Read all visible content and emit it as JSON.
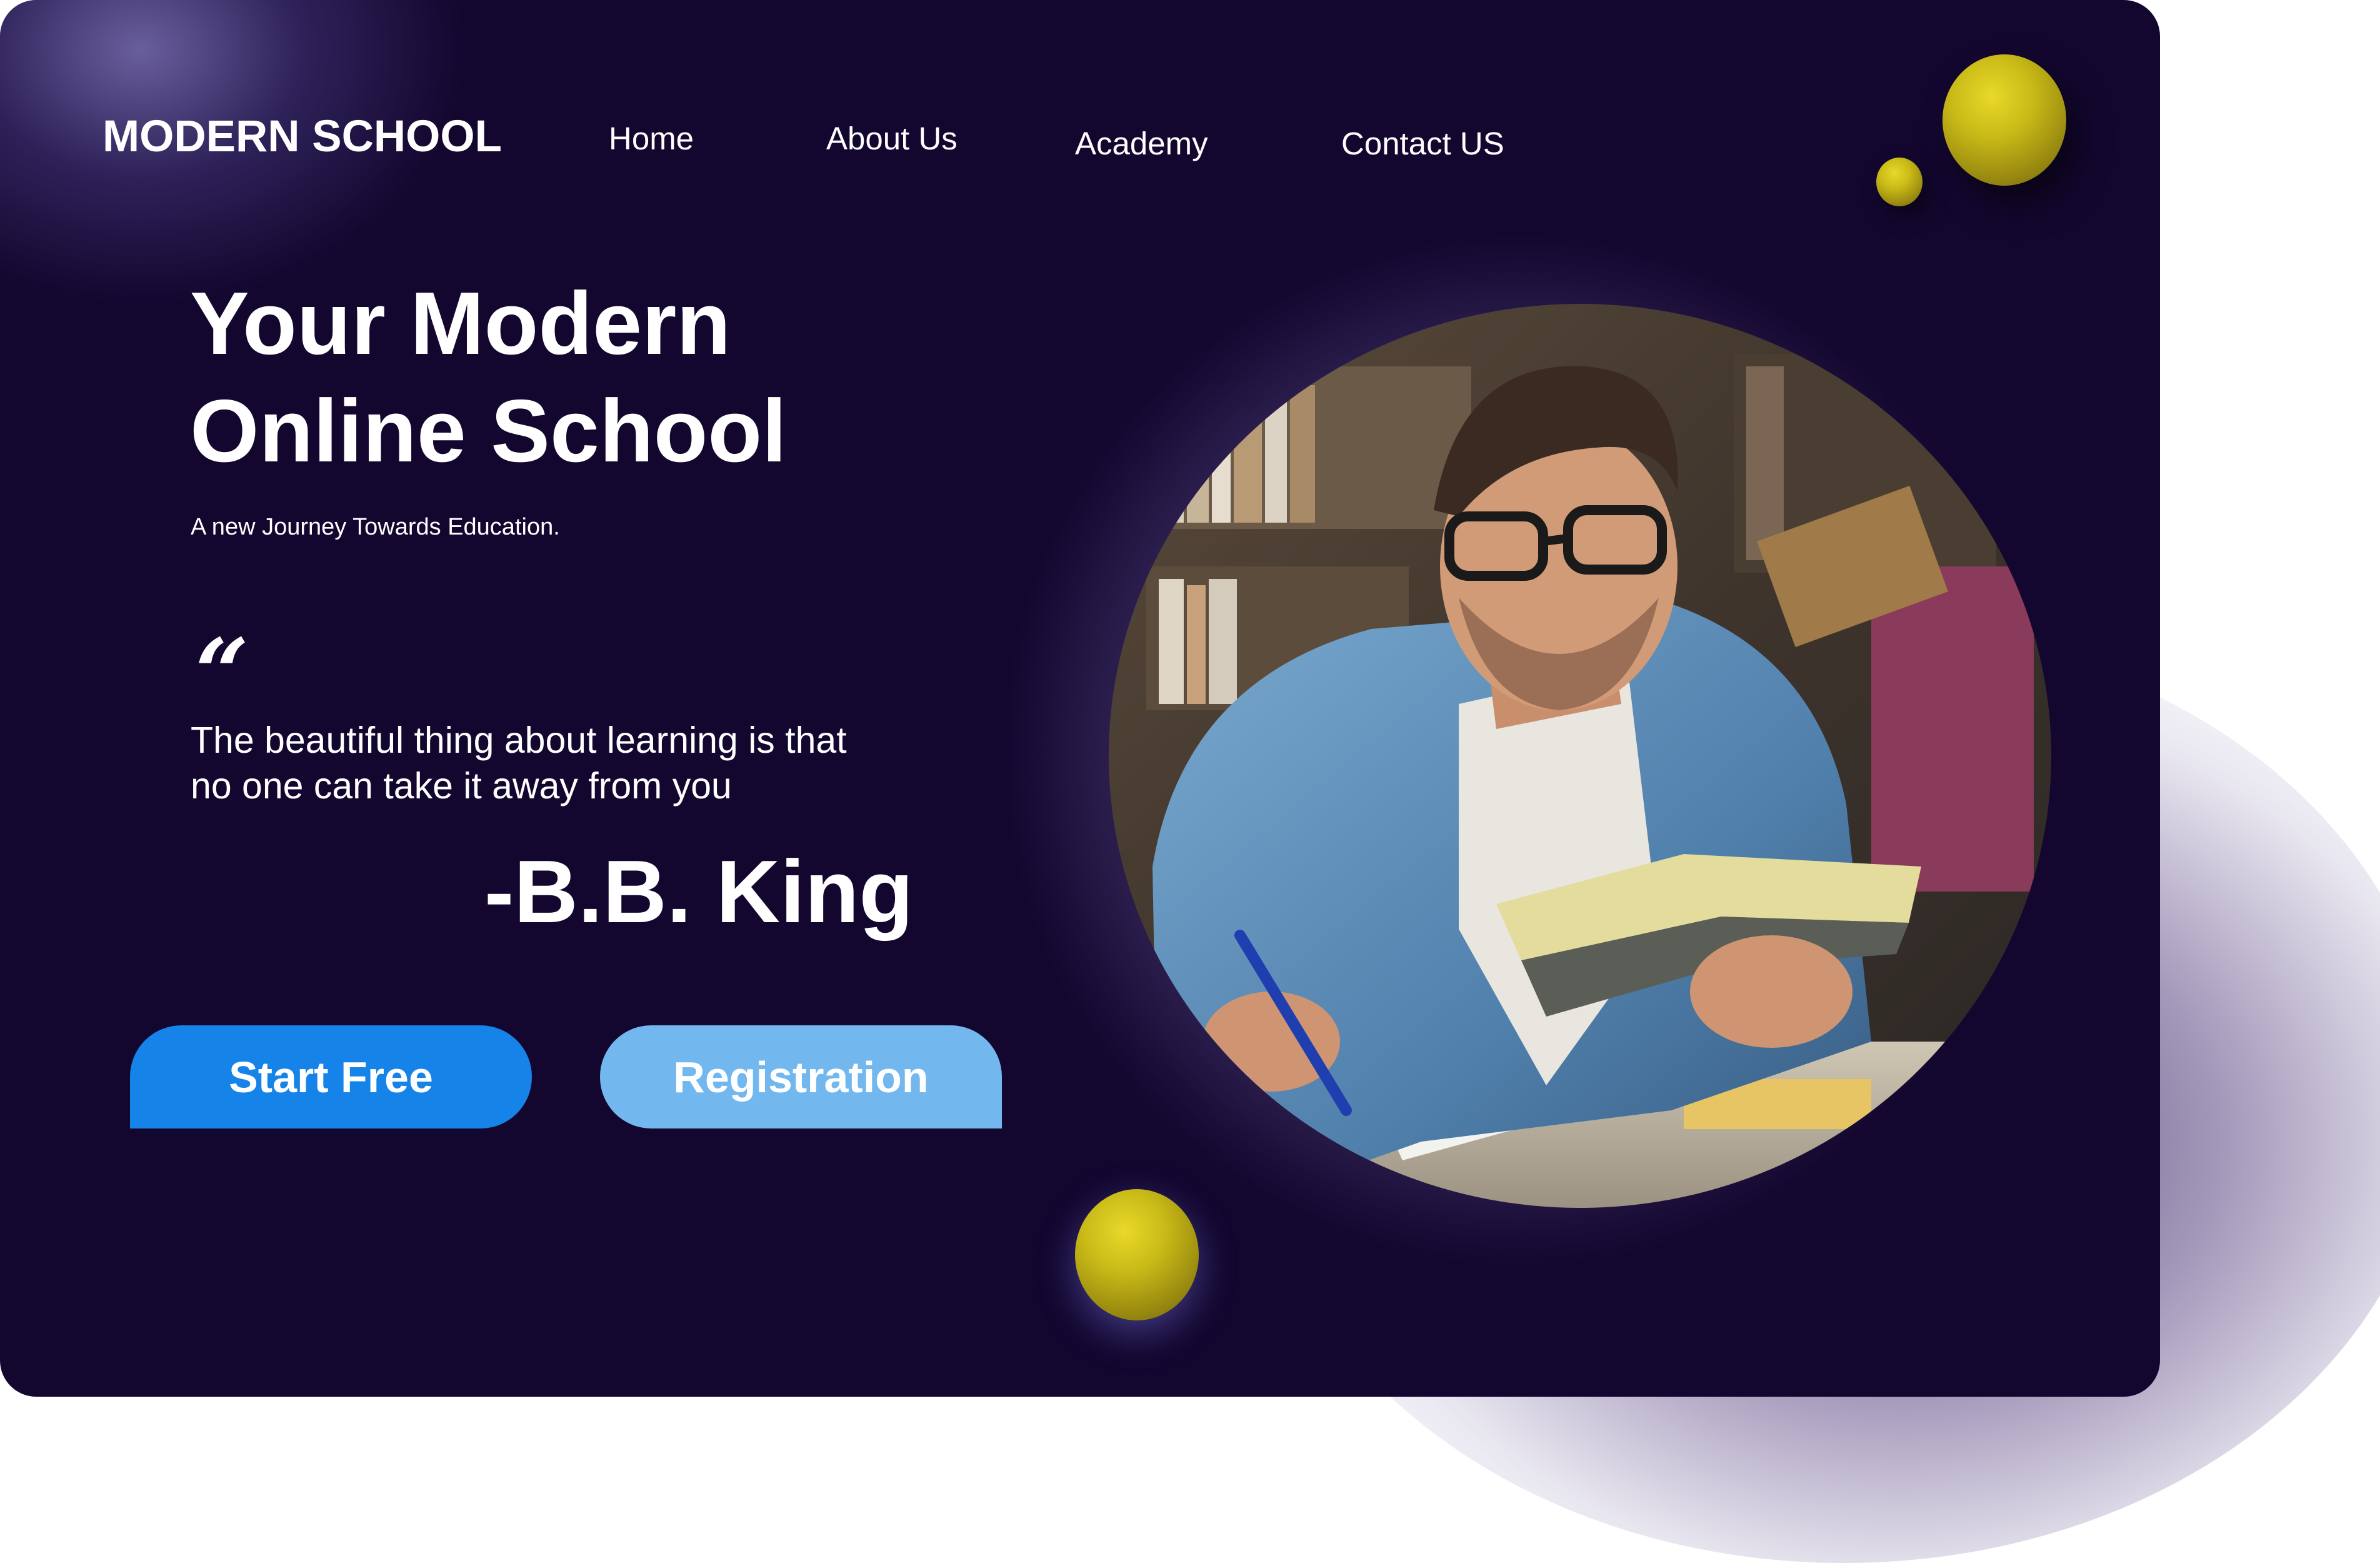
{
  "brand": {
    "name": "MODERN SCHOOL"
  },
  "nav": {
    "items": [
      {
        "label": "Home"
      },
      {
        "label": "About Us"
      },
      {
        "label": "Academy"
      },
      {
        "label": "Contact US"
      }
    ]
  },
  "hero": {
    "title_line1": "Your Modern",
    "title_line2": "Online School",
    "subtitle": "A new Journey Towards Education.",
    "quote_mark": "“",
    "quote_line1": "The beautiful thing about learning is that",
    "quote_line2": "no one can take it away from you",
    "quote_author": "-B.B. King"
  },
  "buttons": {
    "start_label": "Start Free",
    "registration_label": "Registration"
  },
  "colors": {
    "background": "#13072f",
    "primary_button": "#1683e8",
    "secondary_button": "#72b8ef",
    "accent_ball": "#c9ba18",
    "text": "#ffffff"
  },
  "icons": {
    "quote": "quote-icon",
    "decor": "decorative-sphere-icon"
  }
}
